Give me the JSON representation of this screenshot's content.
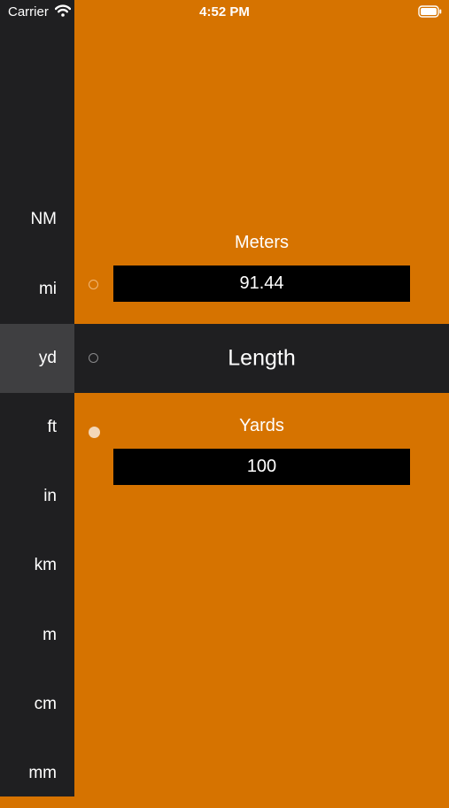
{
  "status_bar": {
    "carrier": "Carrier",
    "time": "4:52 PM"
  },
  "sidebar": {
    "items": [
      {
        "label": "NM"
      },
      {
        "label": "mi"
      },
      {
        "label": "yd",
        "selected": true
      },
      {
        "label": "ft"
      },
      {
        "label": "in"
      },
      {
        "label": "km"
      },
      {
        "label": "m"
      },
      {
        "label": "cm"
      },
      {
        "label": "mm"
      }
    ]
  },
  "top_unit": {
    "label": "Meters",
    "value": "91.44"
  },
  "category": {
    "title": "Length"
  },
  "bottom_unit": {
    "label": "Yards",
    "value": "100"
  },
  "colors": {
    "accent": "#d67300",
    "sidebar": "#1f1f21",
    "selected": "#3f3f41"
  }
}
